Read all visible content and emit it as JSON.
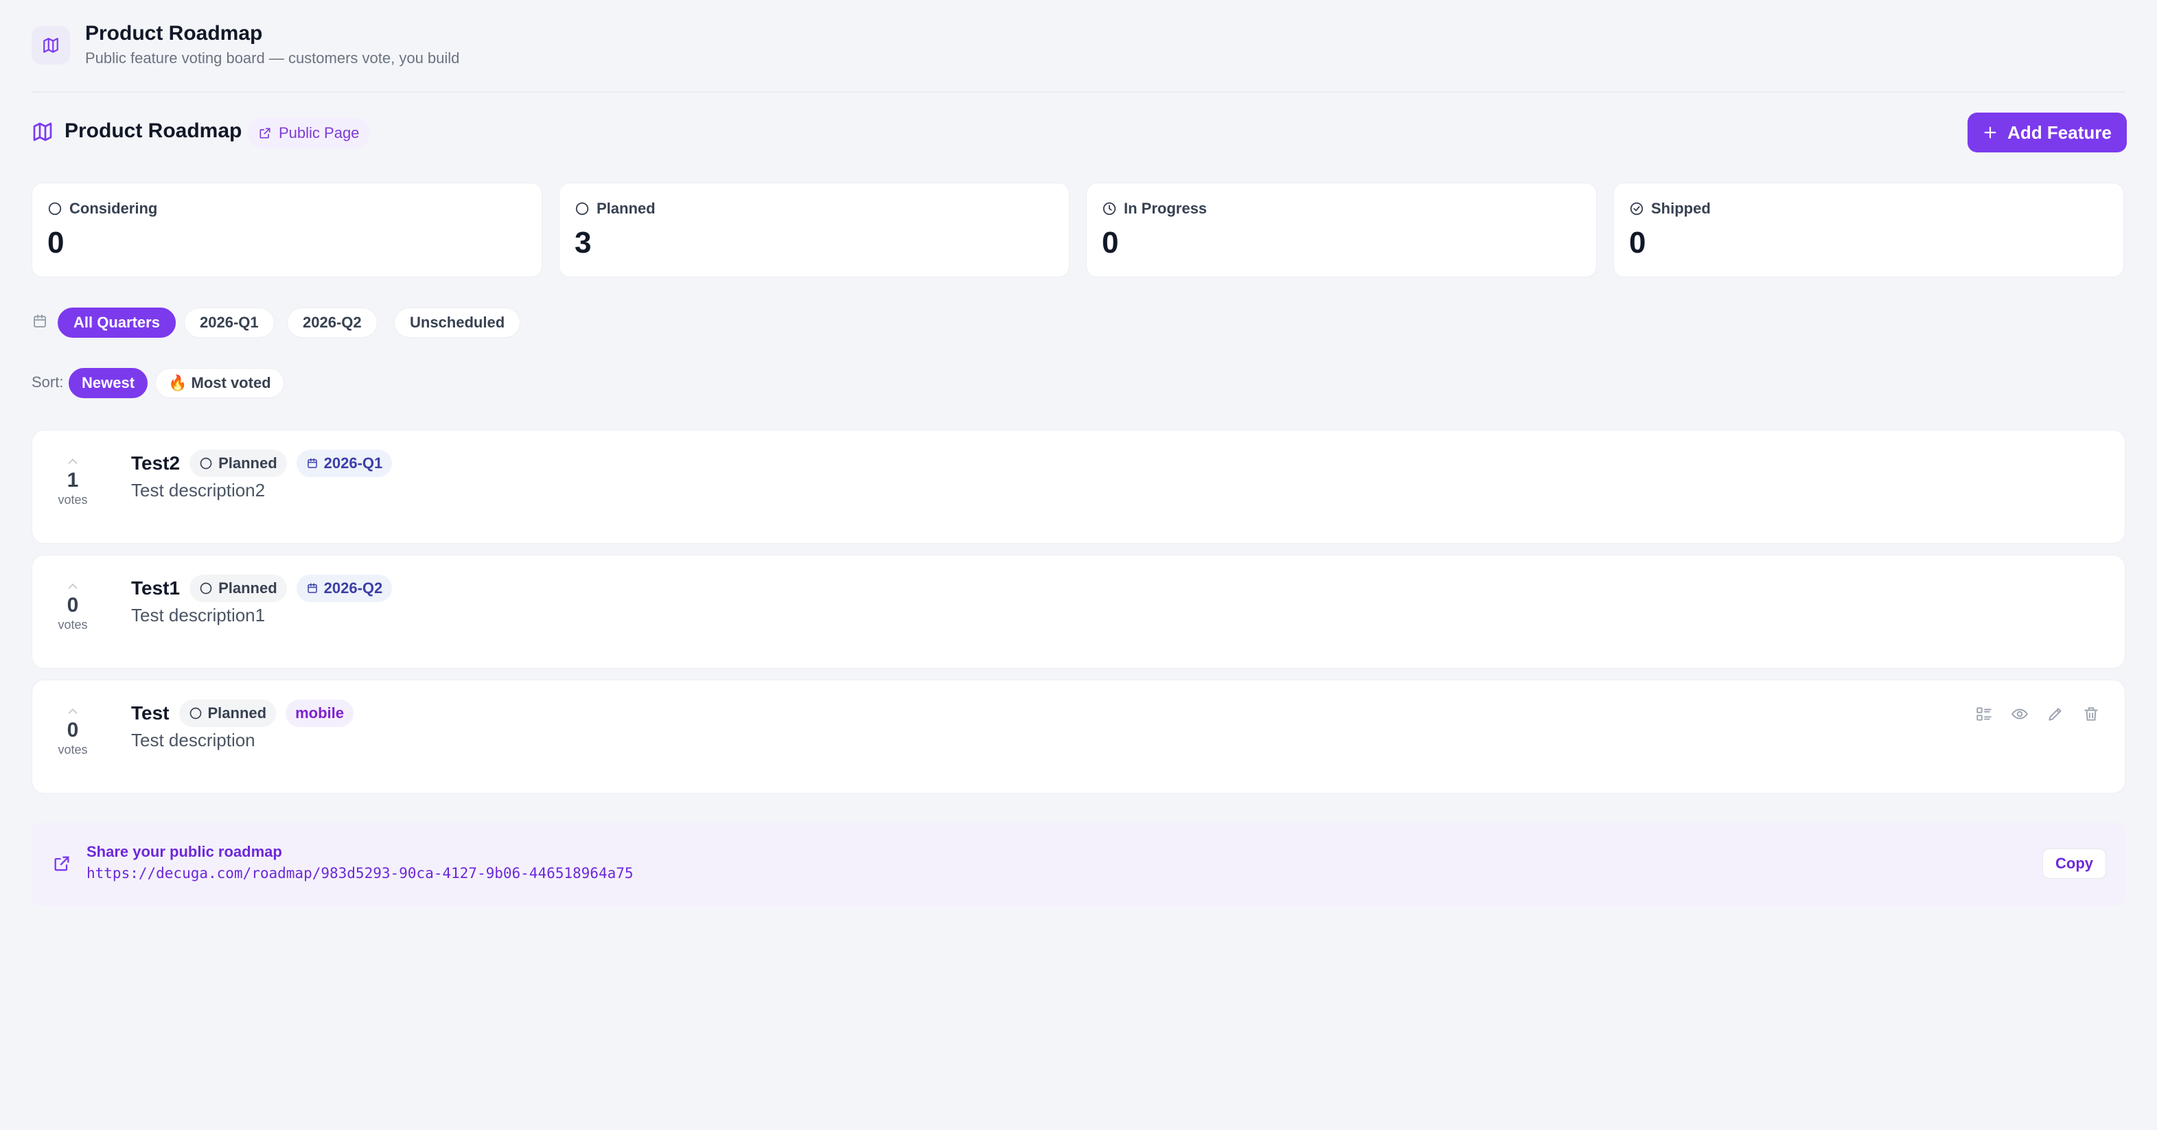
{
  "app": {
    "title": "Product Roadmap",
    "subtitle": "Public feature voting board — customers vote, you build",
    "icon": "map-icon"
  },
  "toolbar": {
    "page_title": "Product Roadmap",
    "public_page_label": "Public Page",
    "add_feature_label": "Add Feature"
  },
  "stats": [
    {
      "label": "Considering",
      "value": "0",
      "icon": "circle-icon"
    },
    {
      "label": "Planned",
      "value": "3",
      "icon": "circle-icon"
    },
    {
      "label": "In Progress",
      "value": "0",
      "icon": "clock-icon"
    },
    {
      "label": "Shipped",
      "value": "0",
      "icon": "check-circle-icon"
    }
  ],
  "quarter_filter": {
    "options": [
      "All Quarters",
      "2026-Q1",
      "2026-Q2",
      "Unscheduled"
    ],
    "selected": "All Quarters"
  },
  "sort": {
    "label": "Sort:",
    "options": [
      "Newest",
      "🔥 Most voted"
    ],
    "selected": "Newest"
  },
  "features": [
    {
      "title": "Test2",
      "status": "Planned",
      "badge": "2026-Q1",
      "badge_kind": "quarter",
      "description": "Test description2",
      "votes": "1",
      "votes_label": "votes"
    },
    {
      "title": "Test1",
      "status": "Planned",
      "badge": "2026-Q2",
      "badge_kind": "quarter",
      "description": "Test description1",
      "votes": "0",
      "votes_label": "votes"
    },
    {
      "title": "Test",
      "status": "Planned",
      "badge": "mobile",
      "badge_kind": "tag",
      "description": "Test description",
      "votes": "0",
      "votes_label": "votes"
    }
  ],
  "share": {
    "title": "Share your public roadmap",
    "url": "https://decuga.com/roadmap/983d5293-90ca-4127-9b06-446518964a75",
    "copy_label": "Copy"
  },
  "colors": {
    "accent": "#7c3aed",
    "background": "#f4f5f9",
    "card": "#ffffff"
  }
}
